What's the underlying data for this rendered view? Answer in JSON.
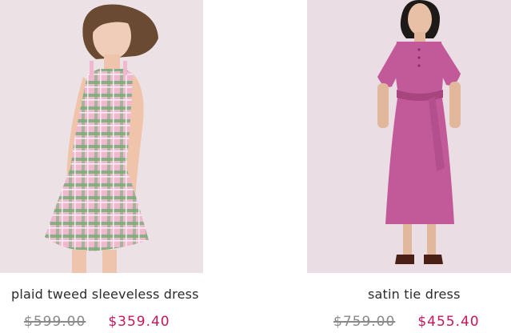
{
  "products": [
    {
      "name": "plaid tweed sleeveless dress",
      "original_price": "$599.00",
      "sale_price": "$359.40",
      "image_icon": "model-in-plaid-dress-image",
      "colors": {
        "background": "#ece2e6",
        "dress_pink": "#e9a8c3",
        "dress_green": "#7bb07a"
      }
    },
    {
      "name": "satin tie dress",
      "original_price": "$759.00",
      "sale_price": "$455.40",
      "image_icon": "model-in-satin-dress-image",
      "colors": {
        "background": "#eadde3",
        "dress": "#c25a9a"
      }
    }
  ],
  "colors": {
    "sale_price": "#c2185b",
    "original_price": "#8a8a8a",
    "name": "#2b2b2b"
  }
}
